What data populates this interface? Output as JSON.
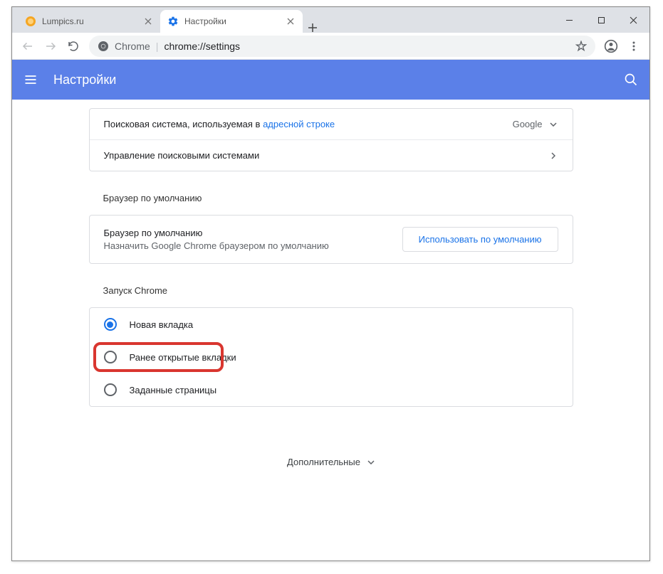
{
  "tabs": [
    {
      "title": "Lumpics.ru",
      "active": false,
      "favicon_color": "#f5a623"
    },
    {
      "title": "Настройки",
      "active": true,
      "favicon_color": "#1a73e8"
    }
  ],
  "address": {
    "scheme": "Chrome",
    "path": "chrome://settings"
  },
  "appbar": {
    "title": "Настройки"
  },
  "search_engine": {
    "label_prefix": "Поисковая система, используемая в ",
    "label_link": "адресной строке",
    "value": "Google",
    "manage_label": "Управление поисковыми системами"
  },
  "default_browser": {
    "section_title": "Браузер по умолчанию",
    "title": "Браузер по умолчанию",
    "subtitle": "Назначить Google Chrome браузером по умолчанию",
    "button": "Использовать по умолчанию"
  },
  "startup": {
    "section_title": "Запуск Chrome",
    "options": [
      {
        "label": "Новая вкладка",
        "checked": true
      },
      {
        "label": "Ранее открытые вкладки",
        "checked": false,
        "highlight": true
      },
      {
        "label": "Заданные страницы",
        "checked": false
      }
    ]
  },
  "advanced": {
    "label": "Дополнительные"
  }
}
